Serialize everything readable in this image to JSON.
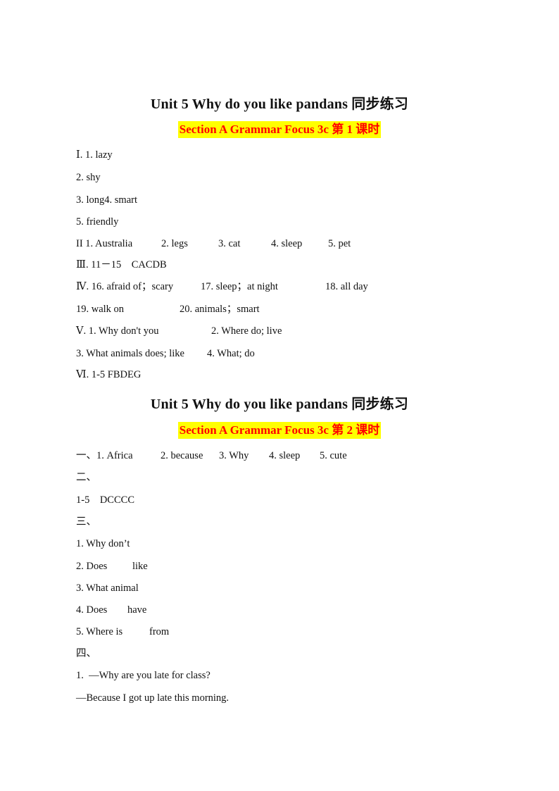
{
  "sections": [
    {
      "title": "Unit 5 Why do you like pandans  同步练习",
      "subtitle": "Section A Grammar Focus 3c 第 1 课时",
      "lines": [
        [
          "Ⅰ. 1. lazy"
        ],
        [
          "2. shy"
        ],
        [
          "3. long4. smart"
        ],
        [
          "5. friendly"
        ],
        [
          "II 1. Australia",
          "2. legs",
          "3. cat",
          "4. sleep",
          "5. pet"
        ],
        [
          "Ⅲ. 11－15    CACDB"
        ],
        [
          "Ⅳ. 16. afraid of；scary",
          "17. sleep；at night",
          "18. all day"
        ],
        [
          "19. walk on",
          "20. animals；smart"
        ],
        [
          "Ⅴ. 1. Why don't you",
          "2. Where do; live"
        ],
        [
          "3. What animals does; like",
          "4. What; do"
        ],
        [
          "Ⅵ. 1-5 FBDEG"
        ]
      ]
    },
    {
      "title": "Unit 5 Why do you like pandans  同步练习",
      "subtitle": "Section A Grammar Focus 3c 第 2 课时",
      "lines": [
        [
          "一、1. Africa",
          "2. because",
          "3. Why",
          "4. sleep",
          "5. cute"
        ],
        [
          "二、"
        ],
        [
          "1-5    DCCCC"
        ],
        [
          "三、"
        ],
        [
          "1. Why don’t"
        ],
        [
          "2. Does",
          "like"
        ],
        [
          "3. What animal"
        ],
        [
          "4. Does",
          "have"
        ],
        [
          "5. Where is",
          "from"
        ],
        [
          "四、"
        ],
        [
          "1.  —Why are you late for class?"
        ],
        [
          "—Because I got up late this morning."
        ]
      ]
    }
  ],
  "colors": {
    "highlight": "#ffff00",
    "subtitle_text": "#ff0000"
  }
}
